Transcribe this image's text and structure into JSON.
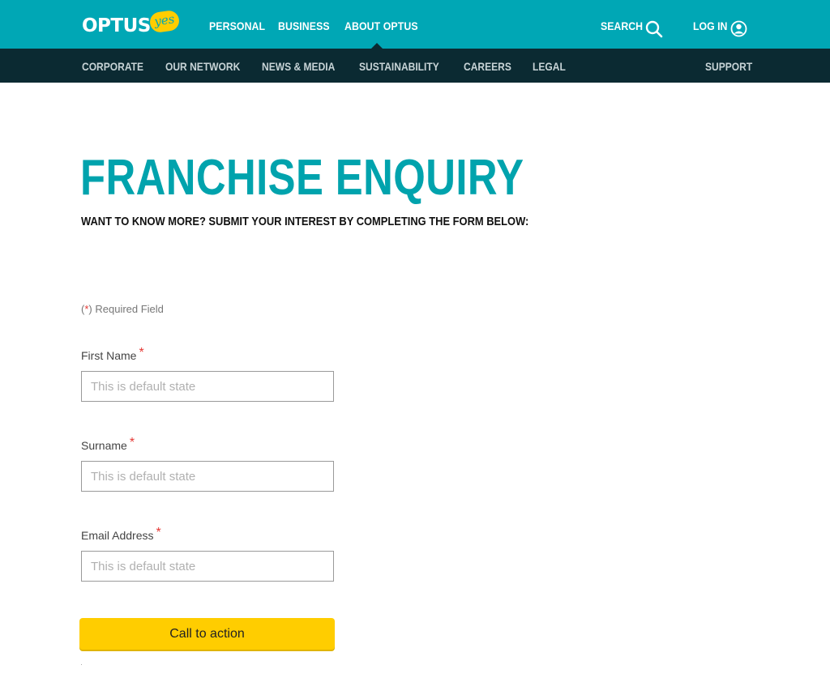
{
  "brand": {
    "logo_text": "OPTUS",
    "logo_badge": "yes",
    "colors": {
      "primary": "#00a7b5",
      "dark": "#0b2a32",
      "accent": "#ffcd00",
      "required": "#e53935"
    }
  },
  "top_nav": {
    "items": [
      {
        "label": "PERSONAL"
      },
      {
        "label": "BUSINESS"
      },
      {
        "label": "ABOUT OPTUS",
        "active": true
      }
    ]
  },
  "utility": {
    "search_label": "SEARCH",
    "search_icon": "search-icon",
    "login_label": "LOG IN",
    "login_icon": "user-icon"
  },
  "sub_nav": {
    "items": [
      {
        "label": "CORPORATE"
      },
      {
        "label": "OUR NETWORK"
      },
      {
        "label": "NEWS & MEDIA"
      },
      {
        "label": "SUSTAINABILITY"
      },
      {
        "label": "CAREERS"
      },
      {
        "label": "LEGAL"
      }
    ],
    "support_label": "SUPPORT"
  },
  "page": {
    "title": "FRANCHISE ENQUIRY",
    "subtitle": "WANT TO KNOW MORE? SUBMIT YOUR INTEREST BY COMPLETING THE FORM BELOW:"
  },
  "form": {
    "required_note": {
      "open": "(",
      "star": "*",
      "close": ")",
      "text": " Required Field"
    },
    "fields": [
      {
        "label": "First Name",
        "required_mark": "*",
        "value": "",
        "placeholder": "This is default state"
      },
      {
        "label": "Surname",
        "required_mark": "*",
        "value": "",
        "placeholder": "This is default state"
      },
      {
        "label": "Email Address",
        "required_mark": "*",
        "value": "",
        "placeholder": "This is default state"
      }
    ],
    "submit_label": "Call to action"
  }
}
